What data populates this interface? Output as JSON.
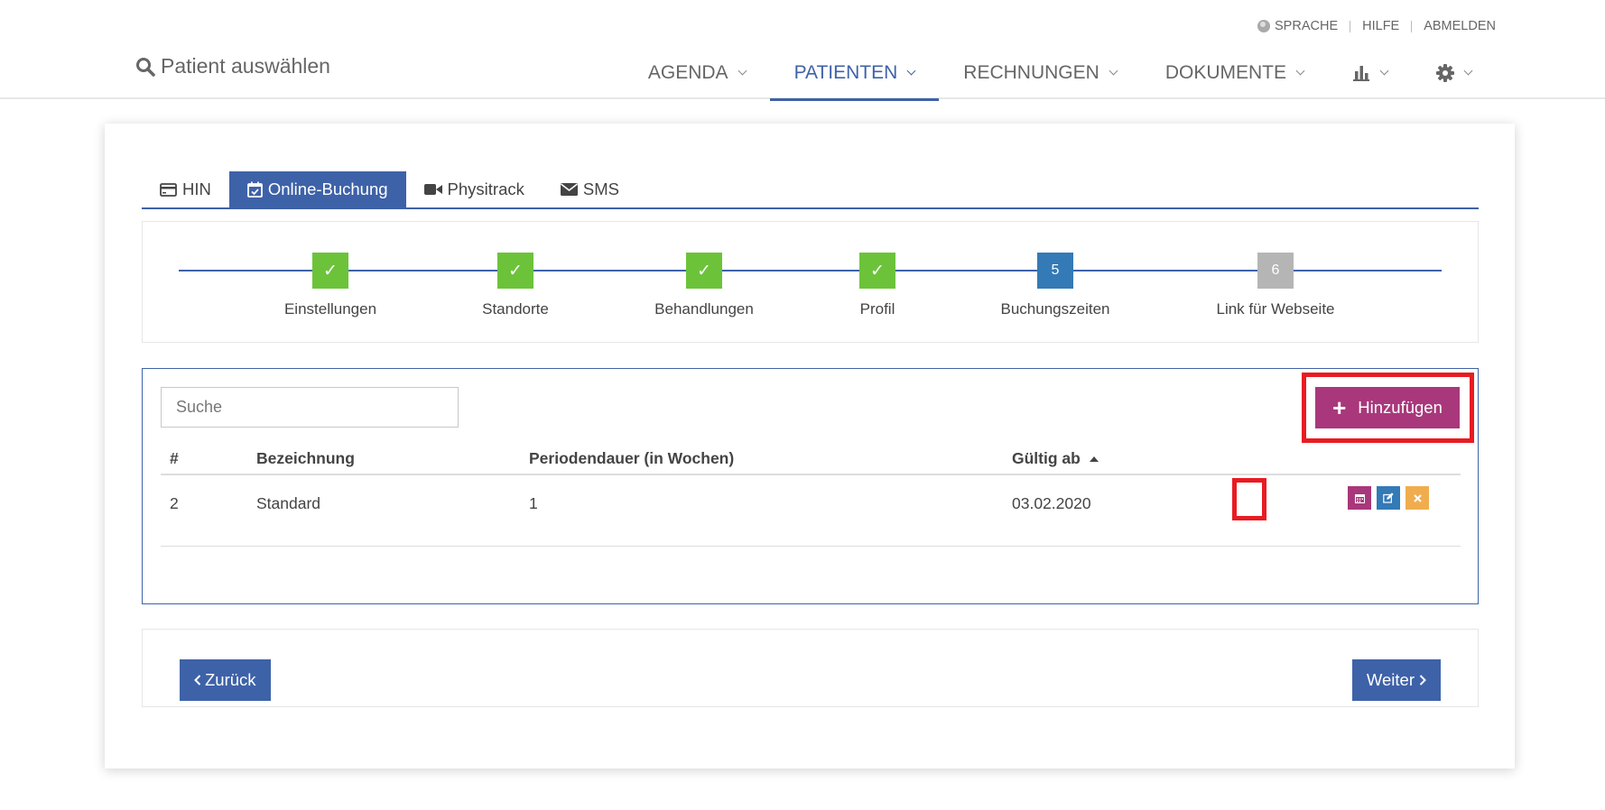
{
  "header": {
    "utility": {
      "language": "SPRACHE",
      "help": "HILFE",
      "logout": "ABMELDEN"
    },
    "patient_search": "Patient auswählen",
    "nav": [
      {
        "label": "AGENDA",
        "active": false
      },
      {
        "label": "PATIENTEN",
        "active": true
      },
      {
        "label": "RECHNUNGEN",
        "active": false
      },
      {
        "label": "DOKUMENTE",
        "active": false
      }
    ],
    "nav_icons": [
      "bar-chart-icon",
      "gear-icon"
    ]
  },
  "tabs": [
    {
      "label": "HIN",
      "icon": "credit-card-icon",
      "active": false
    },
    {
      "label": "Online-Buchung",
      "icon": "calendar-check-icon",
      "active": true
    },
    {
      "label": "Physitrack",
      "icon": "video-camera-icon",
      "active": false
    },
    {
      "label": "SMS",
      "icon": "envelope-icon",
      "active": false
    }
  ],
  "stepper": [
    {
      "label": "Einstellungen",
      "state": "done",
      "mark": "✓"
    },
    {
      "label": "Standorte",
      "state": "done",
      "mark": "✓"
    },
    {
      "label": "Behandlungen",
      "state": "done",
      "mark": "✓"
    },
    {
      "label": "Profil",
      "state": "done",
      "mark": "✓"
    },
    {
      "label": "Buchungszeiten",
      "state": "current",
      "mark": "5"
    },
    {
      "label": "Link für Webseite",
      "state": "pending",
      "mark": "6"
    }
  ],
  "table": {
    "search_placeholder": "Suche",
    "add_label": "Hinzufügen",
    "columns": [
      "#",
      "Bezeichnung",
      "Periodendauer (in Wochen)",
      "Gültig ab"
    ],
    "sort_column": "Gültig ab",
    "rows": [
      {
        "id": "2",
        "name": "Standard",
        "period": "1",
        "valid_from": "03.02.2020"
      }
    ]
  },
  "footer": {
    "back_label": "Zurück",
    "next_label": "Weiter"
  },
  "colors": {
    "primary": "#3e62a8",
    "success": "#6cc33a",
    "info": "#337ab7",
    "accent": "#a8387b",
    "warning": "#f0ad4e",
    "highlight": "#e81c23"
  }
}
